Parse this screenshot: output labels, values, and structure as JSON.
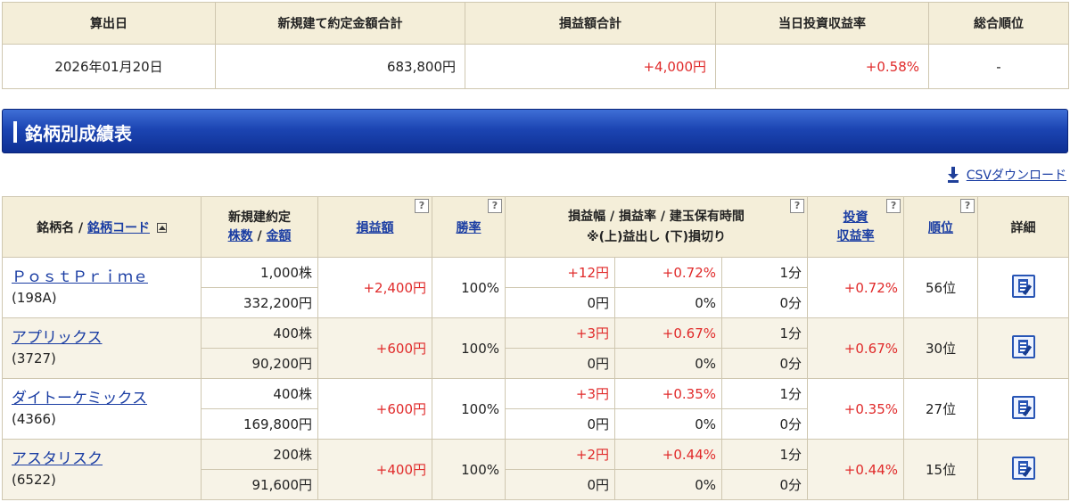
{
  "summary": {
    "headers": [
      "算出日",
      "新規建て約定金額合計",
      "損益額合計",
      "当日投資収益率",
      "総合順位"
    ],
    "values": {
      "date": "2026年01月20日",
      "total_amount": "683,800円",
      "pl_total": "+4,000円",
      "yield": "+0.58%",
      "rank": "-"
    }
  },
  "section": {
    "title": "銘柄別成績表"
  },
  "csv": {
    "label": "CSVダウンロード",
    "icon": "download-icon"
  },
  "table": {
    "headers": {
      "name_prefix": "銘柄名 /",
      "code_link": "銘柄コード",
      "new_contract": "新規建約定",
      "shares_link": "株数",
      "slash": "/",
      "amount_link": "金額",
      "pl": "損益額",
      "win_rate": "勝率",
      "range_line1": "損益幅 / 損益率 / 建玉保有時間",
      "range_line2": "※(上)益出し  (下)損切り",
      "yield_line1": "投資",
      "yield_line2": "収益率",
      "rank": "順位",
      "detail": "詳細",
      "help": "?"
    },
    "rows": [
      {
        "name": "ＰｏｓｔＰｒｉｍｅ",
        "code": "(198A)",
        "shares": "1,000株",
        "amount": "332,200円",
        "pl": "+2,400円",
        "win_rate": "100%",
        "up_range": "+12円",
        "up_rate": "+0.72%",
        "up_time": "1分",
        "down_range": "0円",
        "down_rate": "0%",
        "down_time": "0分",
        "yield": "+0.72%",
        "rank": "56位"
      },
      {
        "name": "アプリックス",
        "code": "(3727)",
        "shares": "400株",
        "amount": "90,200円",
        "pl": "+600円",
        "win_rate": "100%",
        "up_range": "+3円",
        "up_rate": "+0.67%",
        "up_time": "1分",
        "down_range": "0円",
        "down_rate": "0%",
        "down_time": "0分",
        "yield": "+0.67%",
        "rank": "30位"
      },
      {
        "name": "ダイトーケミックス",
        "code": "(4366)",
        "shares": "400株",
        "amount": "169,800円",
        "pl": "+600円",
        "win_rate": "100%",
        "up_range": "+3円",
        "up_rate": "+0.35%",
        "up_time": "1分",
        "down_range": "0円",
        "down_rate": "0%",
        "down_time": "0分",
        "yield": "+0.35%",
        "rank": "27位"
      },
      {
        "name": "アスタリスク",
        "code": "(6522)",
        "shares": "200株",
        "amount": "91,600円",
        "pl": "+400円",
        "win_rate": "100%",
        "up_range": "+2円",
        "up_rate": "+0.44%",
        "up_time": "1分",
        "down_range": "0円",
        "down_rate": "0%",
        "down_time": "0分",
        "yield": "+0.44%",
        "rank": "15位"
      }
    ]
  },
  "colors": {
    "positive": "#e02a2a",
    "link": "#1a3da3",
    "header_bg": "#f4eed9",
    "bar": "#1c45b3"
  }
}
